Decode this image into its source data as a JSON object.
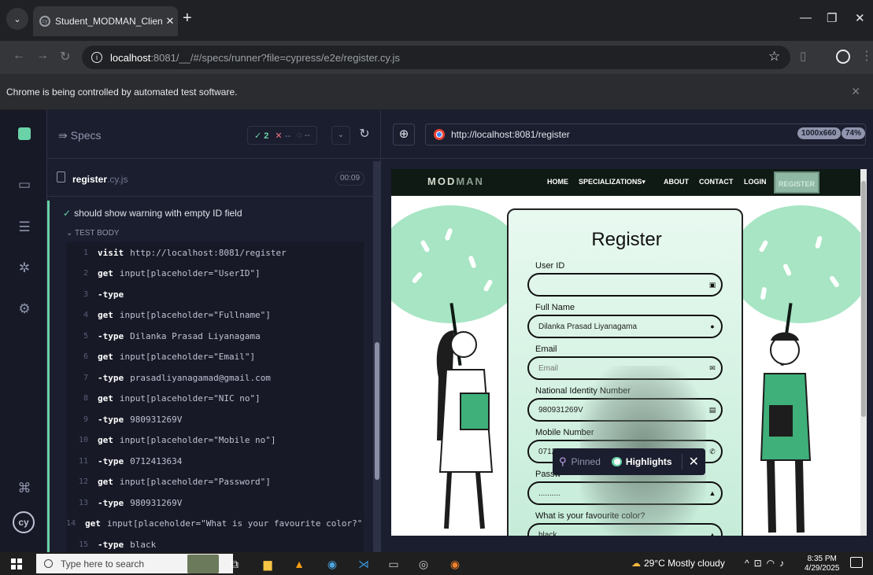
{
  "browser": {
    "tab_title": "Student_MODMAN_Client-main",
    "url_host": "localhost",
    "url_path": ":8081/__/#/specs/runner?file=cypress/e2e/register.cy.js",
    "infobar": "Chrome is being controlled by automated test software."
  },
  "reporter": {
    "specs_label": "Specs",
    "passed": "2",
    "failed": "--",
    "pending": "--",
    "file_name": "register",
    "file_ext": ".cy.js",
    "duration": "00:09",
    "test_title": "should show warning with empty ID field",
    "test_body_label": "TEST BODY",
    "commands": [
      {
        "n": "1",
        "name": "visit",
        "msg": "http://localhost:8081/register"
      },
      {
        "n": "2",
        "name": "get",
        "msg": "input[placeholder=\"UserID\"]"
      },
      {
        "n": "3",
        "name": "-type",
        "msg": ""
      },
      {
        "n": "4",
        "name": "get",
        "msg": "input[placeholder=\"Fullname\"]"
      },
      {
        "n": "5",
        "name": "-type",
        "msg": "Dilanka Prasad Liyanagama"
      },
      {
        "n": "6",
        "name": "get",
        "msg": "input[placeholder=\"Email\"]"
      },
      {
        "n": "7",
        "name": "-type",
        "msg": "prasadliyanagamad@gmail.com"
      },
      {
        "n": "8",
        "name": "get",
        "msg": "input[placeholder=\"NIC no\"]"
      },
      {
        "n": "9",
        "name": "-type",
        "msg": "980931269V"
      },
      {
        "n": "10",
        "name": "get",
        "msg": "input[placeholder=\"Mobile no\"]"
      },
      {
        "n": "11",
        "name": "-type",
        "msg": "0712413634"
      },
      {
        "n": "12",
        "name": "get",
        "msg": "input[placeholder=\"Password\"]"
      },
      {
        "n": "13",
        "name": "-type",
        "msg": "980931269V"
      },
      {
        "n": "14",
        "name": "get",
        "msg": "input[placeholder=\"What is your favourite color?\"]"
      },
      {
        "n": "15",
        "name": "-type",
        "msg": "black"
      }
    ]
  },
  "aut": {
    "url": "http://localhost:8081/register",
    "viewport": "1000x660",
    "zoom": "74%"
  },
  "site": {
    "brand_a": "MOD",
    "brand_b": "MAN",
    "nav": {
      "home": "HOME",
      "specializations": "SPECIALIZATIONS",
      "about": "ABOUT",
      "contact": "CONTACT",
      "login": "LOGIN",
      "register": "REGISTER"
    },
    "form": {
      "title": "Register",
      "user_id_label": "User ID",
      "user_id_value": "",
      "full_name_label": "Full Name",
      "full_name_value": "Dilanka Prasad Liyanagama",
      "email_label": "Email",
      "email_placeholder": "Email",
      "nic_label": "National Identity Number",
      "nic_value": "980931269V",
      "mobile_label": "Mobile Number",
      "mobile_value": "0712",
      "password_label": "Passw",
      "password_value": "..........",
      "color_label": "What is your favourite color?",
      "color_value": "black"
    }
  },
  "pinbar": {
    "pinned": "Pinned",
    "highlights": "Highlights"
  },
  "taskbar": {
    "search_placeholder": "Type here to search",
    "weather": "29°C  Mostly cloudy",
    "time": "8:35 PM",
    "date": "4/29/2025"
  }
}
